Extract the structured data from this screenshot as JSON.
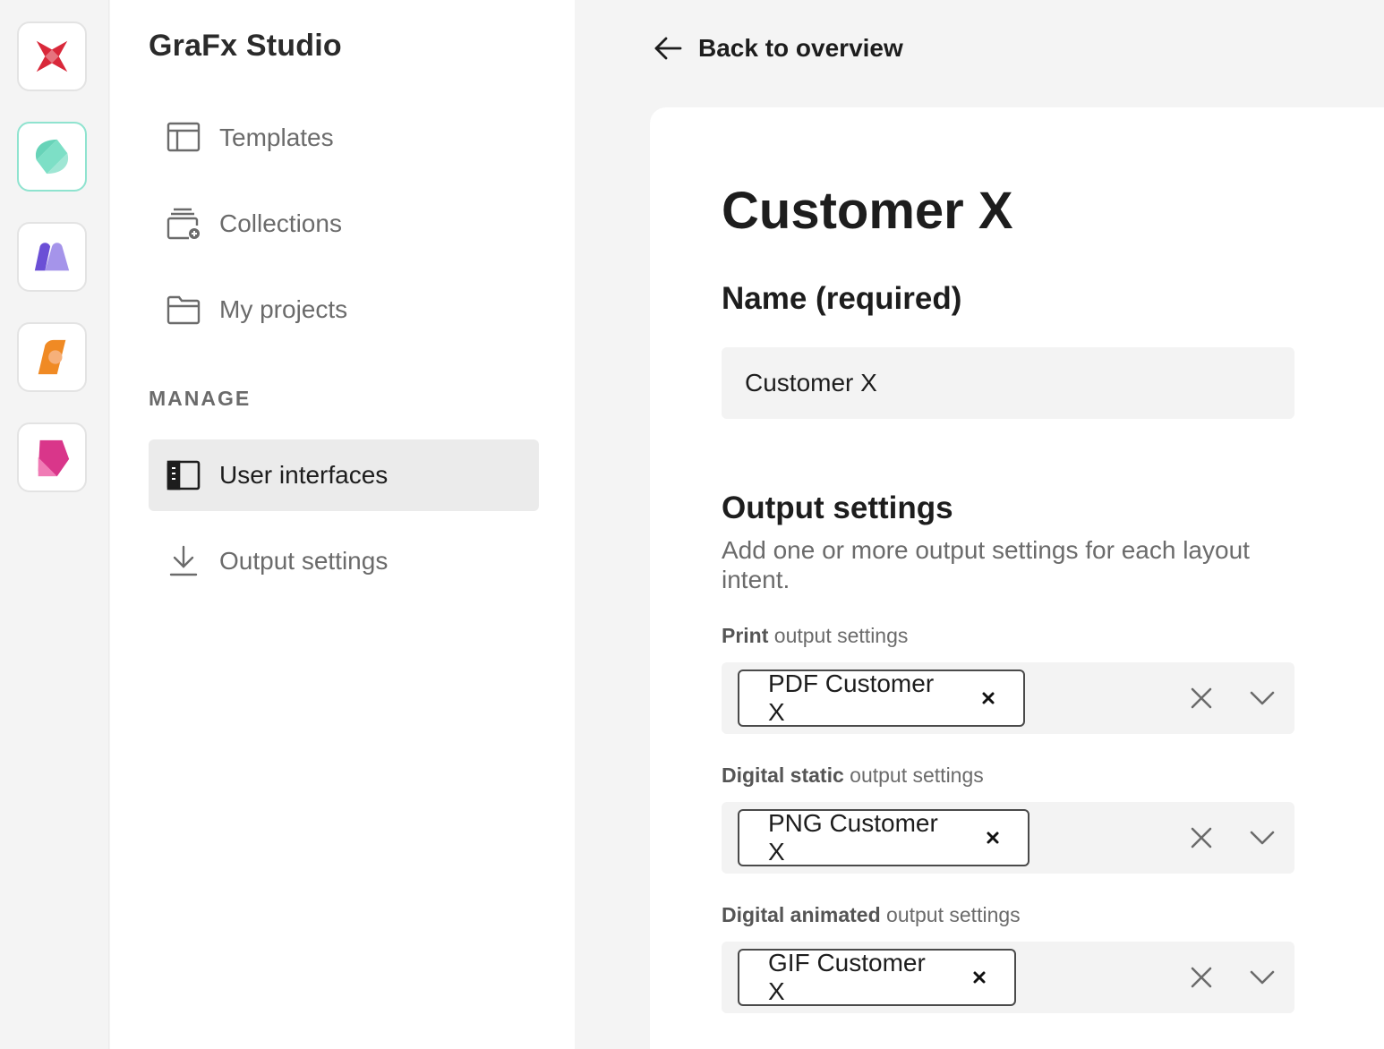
{
  "rail": {
    "apps": [
      {
        "icon": "chili-star-icon",
        "active": false
      },
      {
        "icon": "grafx-studio-icon",
        "active": true
      },
      {
        "icon": "purple-app-icon",
        "active": false
      },
      {
        "icon": "orange-app-icon",
        "active": false
      },
      {
        "icon": "pink-app-icon",
        "active": false
      }
    ]
  },
  "sidebar": {
    "brand": "GraFx Studio",
    "items": [
      {
        "label": "Templates",
        "icon": "templates-icon"
      },
      {
        "label": "Collections",
        "icon": "collections-icon"
      },
      {
        "label": "My projects",
        "icon": "folder-icon"
      }
    ],
    "manage_heading": "MANAGE",
    "manage_items": [
      {
        "label": "User interfaces",
        "icon": "user-interface-icon",
        "active": true
      },
      {
        "label": "Output settings",
        "icon": "download-icon",
        "active": false
      }
    ]
  },
  "header": {
    "back_label": "Back to overview"
  },
  "main": {
    "title": "Customer X",
    "name_heading": "Name (required)",
    "name_value": "Customer X",
    "output_heading": "Output settings",
    "output_description": "Add one or more output settings for each layout intent.",
    "fields": [
      {
        "label_bold": "Print",
        "label_rest": " output settings",
        "chip": "PDF Customer X"
      },
      {
        "label_bold": "Digital static",
        "label_rest": " output settings",
        "chip": "PNG Customer X"
      },
      {
        "label_bold": "Digital animated",
        "label_rest": " output settings",
        "chip": "GIF Customer X"
      }
    ]
  },
  "colors": {
    "accent_active_border": "#8fe3cf",
    "chip_border": "#4a4a4a"
  }
}
